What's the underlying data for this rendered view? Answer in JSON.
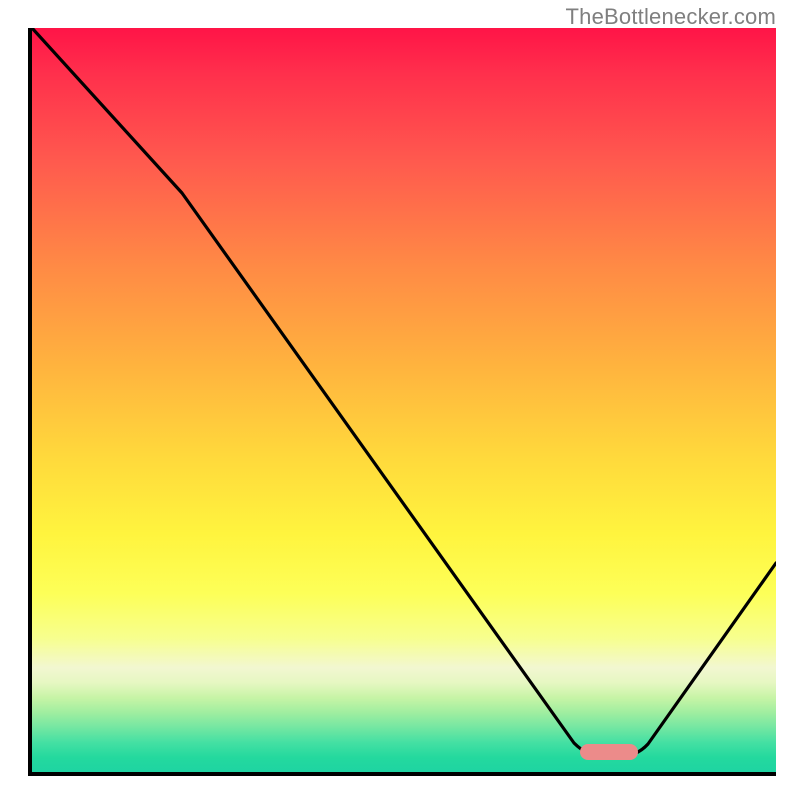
{
  "watermark": "TheBottlenecker.com",
  "chart_data": {
    "type": "line",
    "title": "",
    "xlabel": "",
    "ylabel": "",
    "xlim": [
      0,
      100
    ],
    "ylim": [
      0,
      100
    ],
    "x": [
      0,
      20,
      73,
      79,
      100
    ],
    "y": [
      100,
      78,
      4,
      4,
      28
    ],
    "note": "Values estimated from pixel positions; V-shaped bottleneck curve with flat minimum near x≈73–79.",
    "marker": {
      "x": 76,
      "y": 4,
      "color": "#ec8b8a"
    },
    "background": "vertical heat gradient red→yellow→green"
  }
}
